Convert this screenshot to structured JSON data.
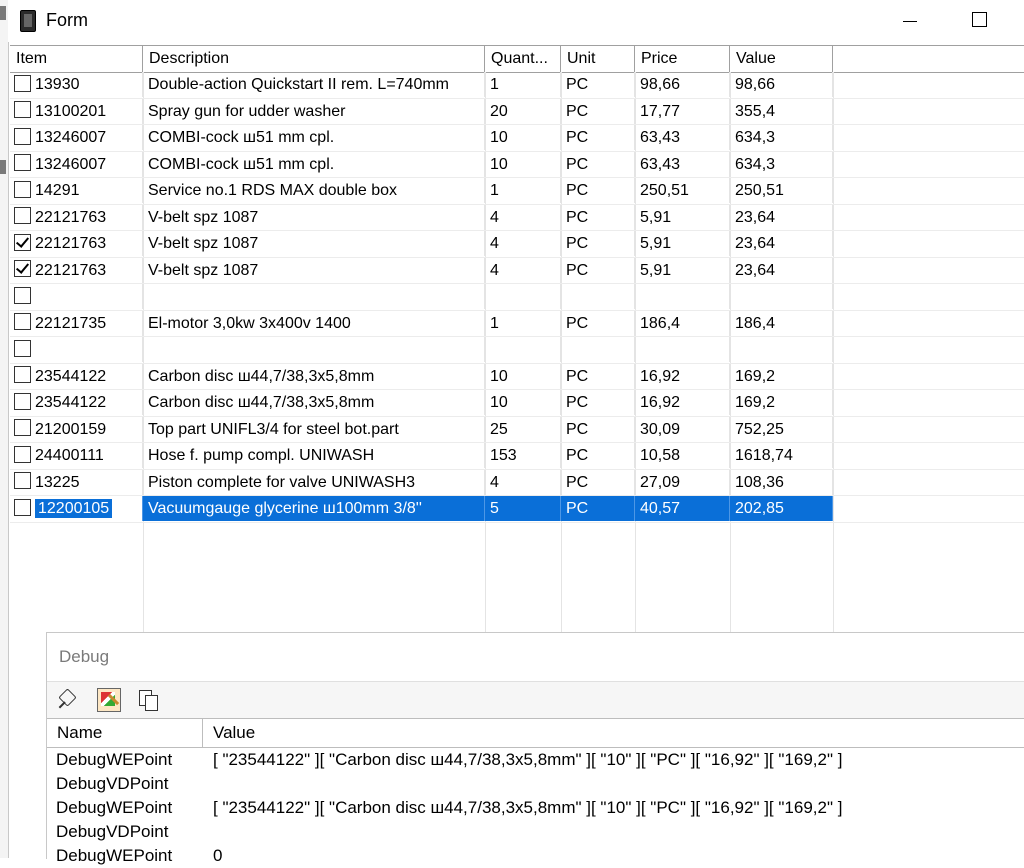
{
  "window": {
    "title": "Form"
  },
  "grid": {
    "columns": [
      "Item",
      "Description",
      "Quant...",
      "Unit",
      "Price",
      "Value"
    ],
    "rows": [
      {
        "checked": false,
        "item": "13930",
        "description": "Double-action Quickstart II rem. L=740mm",
        "quantity": "1",
        "unit": "PC",
        "price": "98,66",
        "value": "98,66"
      },
      {
        "checked": false,
        "item": "13100201",
        "description": "Spray gun for udder washer",
        "quantity": "20",
        "unit": "PC",
        "price": "17,77",
        "value": "355,4"
      },
      {
        "checked": false,
        "item": "13246007",
        "description": "COMBI-cock ш51 mm cpl.",
        "quantity": "10",
        "unit": "PC",
        "price": "63,43",
        "value": "634,3"
      },
      {
        "checked": false,
        "item": "13246007",
        "description": "COMBI-cock ш51 mm cpl.",
        "quantity": "10",
        "unit": "PC",
        "price": "63,43",
        "value": "634,3"
      },
      {
        "checked": false,
        "item": "14291",
        "description": "Service no.1 RDS MAX double box",
        "quantity": "1",
        "unit": "PC",
        "price": "250,51",
        "value": "250,51"
      },
      {
        "checked": false,
        "item": "22121763",
        "description": "V-belt spz 1087",
        "quantity": "4",
        "unit": "PC",
        "price": "5,91",
        "value": "23,64"
      },
      {
        "checked": true,
        "item": "22121763",
        "description": "V-belt spz 1087",
        "quantity": "4",
        "unit": "PC",
        "price": "5,91",
        "value": "23,64"
      },
      {
        "checked": true,
        "item": "22121763",
        "description": "V-belt spz 1087",
        "quantity": "4",
        "unit": "PC",
        "price": "5,91",
        "value": "23,64"
      },
      {
        "checked": false,
        "item": "",
        "description": "",
        "quantity": "",
        "unit": "",
        "price": "",
        "value": ""
      },
      {
        "checked": false,
        "item": "22121735",
        "description": "El-motor 3,0kw 3x400v 1400",
        "quantity": "1",
        "unit": "PC",
        "price": "186,4",
        "value": "186,4"
      },
      {
        "checked": false,
        "item": "",
        "description": "",
        "quantity": "",
        "unit": "",
        "price": "",
        "value": ""
      },
      {
        "checked": false,
        "item": "23544122",
        "description": "Carbon disc ш44,7/38,3x5,8mm",
        "quantity": "10",
        "unit": "PC",
        "price": "16,92",
        "value": "169,2"
      },
      {
        "checked": false,
        "item": "23544122",
        "description": "Carbon disc ш44,7/38,3x5,8mm",
        "quantity": "10",
        "unit": "PC",
        "price": "16,92",
        "value": "169,2"
      },
      {
        "checked": false,
        "item": "21200159",
        "description": "Top part UNIFL3/4 for steel bot.part",
        "quantity": "25",
        "unit": "PC",
        "price": "30,09",
        "value": "752,25"
      },
      {
        "checked": false,
        "item": "24400111",
        "description": "Hose f. pump compl. UNIWASH",
        "quantity": "153",
        "unit": "PC",
        "price": "10,58",
        "value": "1618,74"
      },
      {
        "checked": false,
        "item": "13225",
        "description": "Piston complete for valve UNIWASH3",
        "quantity": "4",
        "unit": "PC",
        "price": "27,09",
        "value": "108,36"
      },
      {
        "checked": false,
        "item": "12200105",
        "description": "Vacuumgauge glycerine ш100mm 3/8''",
        "quantity": "5",
        "unit": "PC",
        "price": "40,57",
        "value": "202,85",
        "selected": true
      }
    ]
  },
  "debug": {
    "title": "Debug",
    "columns": [
      "Name",
      "Value"
    ],
    "rows": [
      {
        "name": "DebugWEPoint",
        "value": "[ \"23544122\" ][ \"Carbon disc ш44,7/38,3x5,8mm\" ][ \"10\" ][ \"PC\" ][ \"16,92\" ][ \"169,2\" ]"
      },
      {
        "name": "DebugVDPoint",
        "value": ""
      },
      {
        "name": "DebugWEPoint",
        "value": "[ \"23544122\" ][ \"Carbon disc ш44,7/38,3x5,8mm\" ][ \"10\" ][ \"PC\" ][ \"16,92\" ][ \"169,2\" ]"
      },
      {
        "name": "DebugVDPoint",
        "value": ""
      },
      {
        "name": "DebugWEPoint",
        "value": "0"
      }
    ]
  },
  "colors": {
    "selection": "#0a6fd8",
    "grid_line": "#e4e4e4",
    "header_border": "#a0a0a0"
  }
}
